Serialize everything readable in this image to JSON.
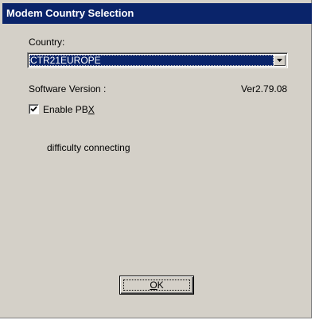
{
  "window": {
    "title": "Modem Country Selection"
  },
  "country": {
    "label": "Country:",
    "selected": "CTR21EUROPE"
  },
  "software": {
    "label": "Software Version :",
    "value": "Ver2.79.08"
  },
  "pbx": {
    "label_prefix": "Enable PB",
    "label_accel": "X",
    "checked": true
  },
  "status": {
    "message": "difficulty connecting"
  },
  "ok_button": {
    "accel": "O",
    "rest": "K"
  },
  "colors": {
    "title_bar": "#0a246a",
    "face": "#d4d0c8",
    "selection": "#0a246a"
  },
  "icons": {
    "dropdown": "chevron-down-icon",
    "check": "checkmark-icon"
  }
}
